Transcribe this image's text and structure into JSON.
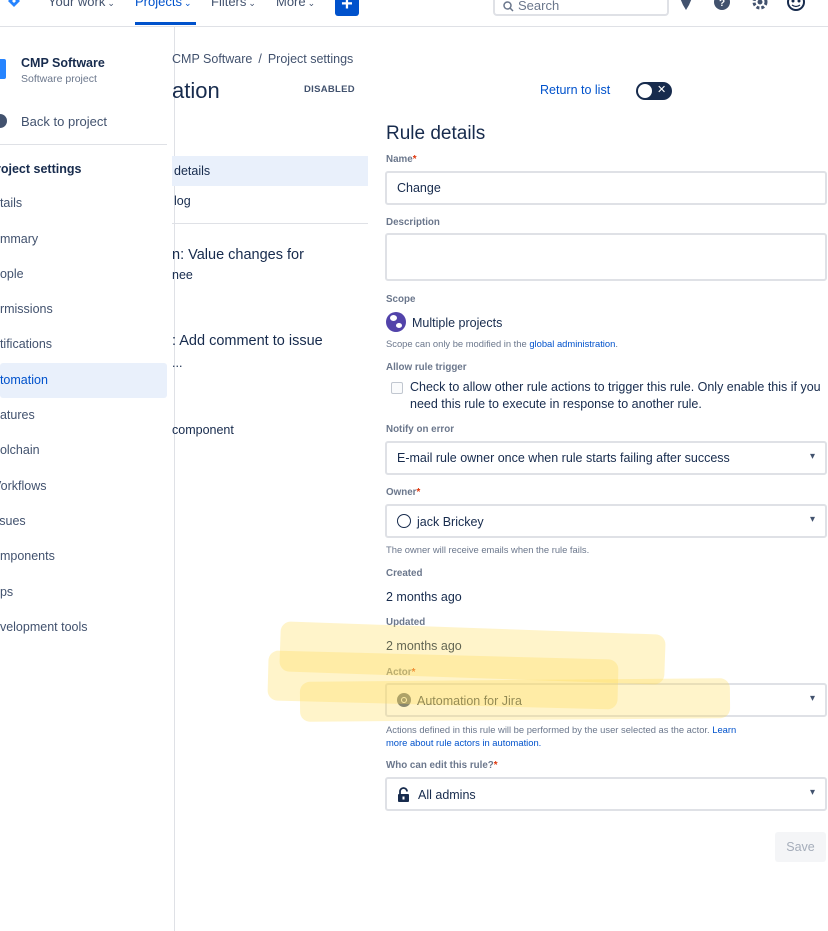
{
  "topnav": {
    "items": [
      {
        "label": "Your work"
      },
      {
        "label": "Projects"
      },
      {
        "label": "Filters"
      },
      {
        "label": "More"
      }
    ],
    "create_label": "+",
    "search_placeholder": "Search",
    "active_color": "#0052cc",
    "icons": [
      "jira-logo-icon",
      "notifications-icon",
      "help-icon",
      "settings-icon",
      "profile-avatar-icon"
    ]
  },
  "sidebar": {
    "project_name": "CMP Software",
    "project_type": "Software project",
    "back_label": "Back to project",
    "heading": "roject settings",
    "items": [
      {
        "label": "etails"
      },
      {
        "label": "ummary"
      },
      {
        "label": "eople"
      },
      {
        "label": "ermissions"
      },
      {
        "label": "otifications"
      },
      {
        "label": "utomation"
      },
      {
        "label": "eatures"
      },
      {
        "label": "oolchain"
      },
      {
        "label": "Vorkflows"
      },
      {
        "label": "ssues"
      },
      {
        "label": "omponents"
      },
      {
        "label": "pps"
      },
      {
        "label": "evelopment tools"
      }
    ],
    "active_index": 5
  },
  "middle": {
    "breadcrumb": [
      "CMP Software",
      "Project settings"
    ],
    "breadcrumb_sep": "/",
    "title": "ation",
    "status_badge": "DISABLED",
    "tabs": [
      {
        "label": "details"
      },
      {
        "label": "log"
      }
    ],
    "components": {
      "c1_line1": "n: Value changes for",
      "c1_line2": "nee",
      "c2_line1": ": Add comment to issue",
      "c2_line2": "...",
      "c3_line1": "component"
    }
  },
  "rule": {
    "return_label": "Return to list",
    "toggle_state": "off",
    "title": "Rule details",
    "name_label": "Name",
    "name_value": "Change",
    "description_label": "Description",
    "description_value": "",
    "scope_label": "Scope",
    "scope_value": "Multiple projects",
    "scope_help_prefix": "Scope can only be modified in the",
    "scope_help_link": "global administration",
    "scope_help_suffix": ".",
    "allow_trigger_label": "Allow rule trigger",
    "allow_trigger_text": "Check to allow other rule actions to trigger this rule. Only enable this if you need this rule to execute in response to another rule.",
    "notify_label": "Notify on error",
    "notify_value": "E-mail rule owner once when rule starts failing after success",
    "owner_label": "Owner",
    "owner_value": "jack Brickey",
    "owner_help": "The owner will receive emails when the rule fails.",
    "created_label": "Created",
    "created_value": "2 months ago",
    "updated_label": "Updated",
    "updated_value": "2 months ago",
    "actor_label": "Actor",
    "actor_value": "Automation for Jira",
    "actor_help_prefix": "Actions defined in this rule will be performed by the user selected as the actor.",
    "actor_help_link_1": "Learn",
    "actor_help_link_2": "more about rule actors in automation.",
    "edit_label": "Who can edit this rule?",
    "edit_value": "All admins",
    "required_mark": "*",
    "save_label": "Save"
  },
  "highlight_color": "#ffdd5a"
}
